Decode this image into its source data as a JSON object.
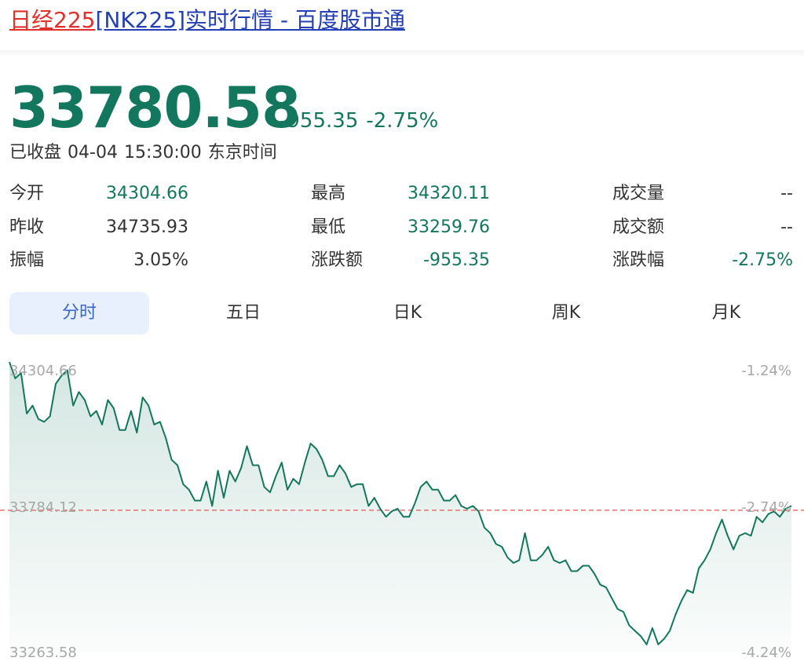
{
  "title": {
    "part1": "日经225",
    "part2": "[NK225]实时行情 - 百度股市通"
  },
  "quote": {
    "price": "33780.58",
    "change": "-955.35",
    "change_pct": "-2.75%",
    "status": "已收盘",
    "date": "04-04",
    "time": "15:30:00",
    "timezone": "东京时间"
  },
  "stats": [
    {
      "label": "今开",
      "value": "34304.66",
      "tone": "green"
    },
    {
      "label": "最高",
      "value": "34320.11",
      "tone": "green"
    },
    {
      "label": "成交量",
      "value": "--",
      "tone": "black"
    },
    {
      "label": "昨收",
      "value": "34735.93",
      "tone": "black"
    },
    {
      "label": "最低",
      "value": "33259.76",
      "tone": "green"
    },
    {
      "label": "成交额",
      "value": "--",
      "tone": "black"
    },
    {
      "label": "振幅",
      "value": "3.05%",
      "tone": "black"
    },
    {
      "label": "涨跌额",
      "value": "-955.35",
      "tone": "green"
    },
    {
      "label": "涨跌幅",
      "value": "-2.75%",
      "tone": "green"
    }
  ],
  "tabs": [
    {
      "label": "分时",
      "active": true
    },
    {
      "label": "五日",
      "active": false
    },
    {
      "label": "日K",
      "active": false
    },
    {
      "label": "周K",
      "active": false
    },
    {
      "label": "月K",
      "active": false
    }
  ],
  "colors": {
    "accent": "#12775c",
    "title_red": "#e0312b",
    "title_blue": "#2440b3",
    "reference_line": "#e57373",
    "tab_active_bg": "#e8f0fd",
    "tab_active_text": "#3b67c9"
  },
  "chart_data": {
    "type": "area",
    "y_tick_labels_left": [
      "34304.66",
      "33784.12",
      "33263.58"
    ],
    "y_tick_labels_right": [
      "-1.24%",
      "-2.74%",
      "-4.24%"
    ],
    "reference_value": 33784.12,
    "ylim": [
      33263.58,
      34304.66
    ],
    "series": [
      {
        "values": [
          34330,
          34270,
          34290,
          34140,
          34170,
          34120,
          34110,
          34130,
          34250,
          34280,
          34300,
          34170,
          34220,
          34190,
          34130,
          34150,
          34100,
          34190,
          34160,
          34080,
          34080,
          34150,
          34070,
          34200,
          34170,
          34100,
          34110,
          34050,
          33970,
          33950,
          33880,
          33860,
          33820,
          33820,
          33890,
          33800,
          33930,
          33830,
          33930,
          33890,
          33940,
          34020,
          33950,
          33950,
          33870,
          33850,
          33910,
          33960,
          33860,
          33900,
          33880,
          33960,
          34030,
          34010,
          33970,
          33910,
          33910,
          33950,
          33920,
          33870,
          33880,
          33880,
          33800,
          33830,
          33790,
          33760,
          33780,
          33790,
          33760,
          33760,
          33810,
          33870,
          33890,
          33860,
          33860,
          33820,
          33820,
          33840,
          33800,
          33790,
          33800,
          33780,
          33720,
          33700,
          33660,
          33650,
          33610,
          33590,
          33600,
          33700,
          33600,
          33600,
          33620,
          33650,
          33600,
          33590,
          33600,
          33560,
          33560,
          33580,
          33580,
          33550,
          33510,
          33500,
          33460,
          33420,
          33410,
          33360,
          33340,
          33320,
          33290,
          33350,
          33290,
          33310,
          33340,
          33400,
          33450,
          33490,
          33480,
          33570,
          33600,
          33640,
          33700,
          33750,
          33690,
          33640,
          33690,
          33700,
          33690,
          33760,
          33740,
          33770,
          33780,
          33760,
          33790,
          33800
        ]
      }
    ]
  }
}
